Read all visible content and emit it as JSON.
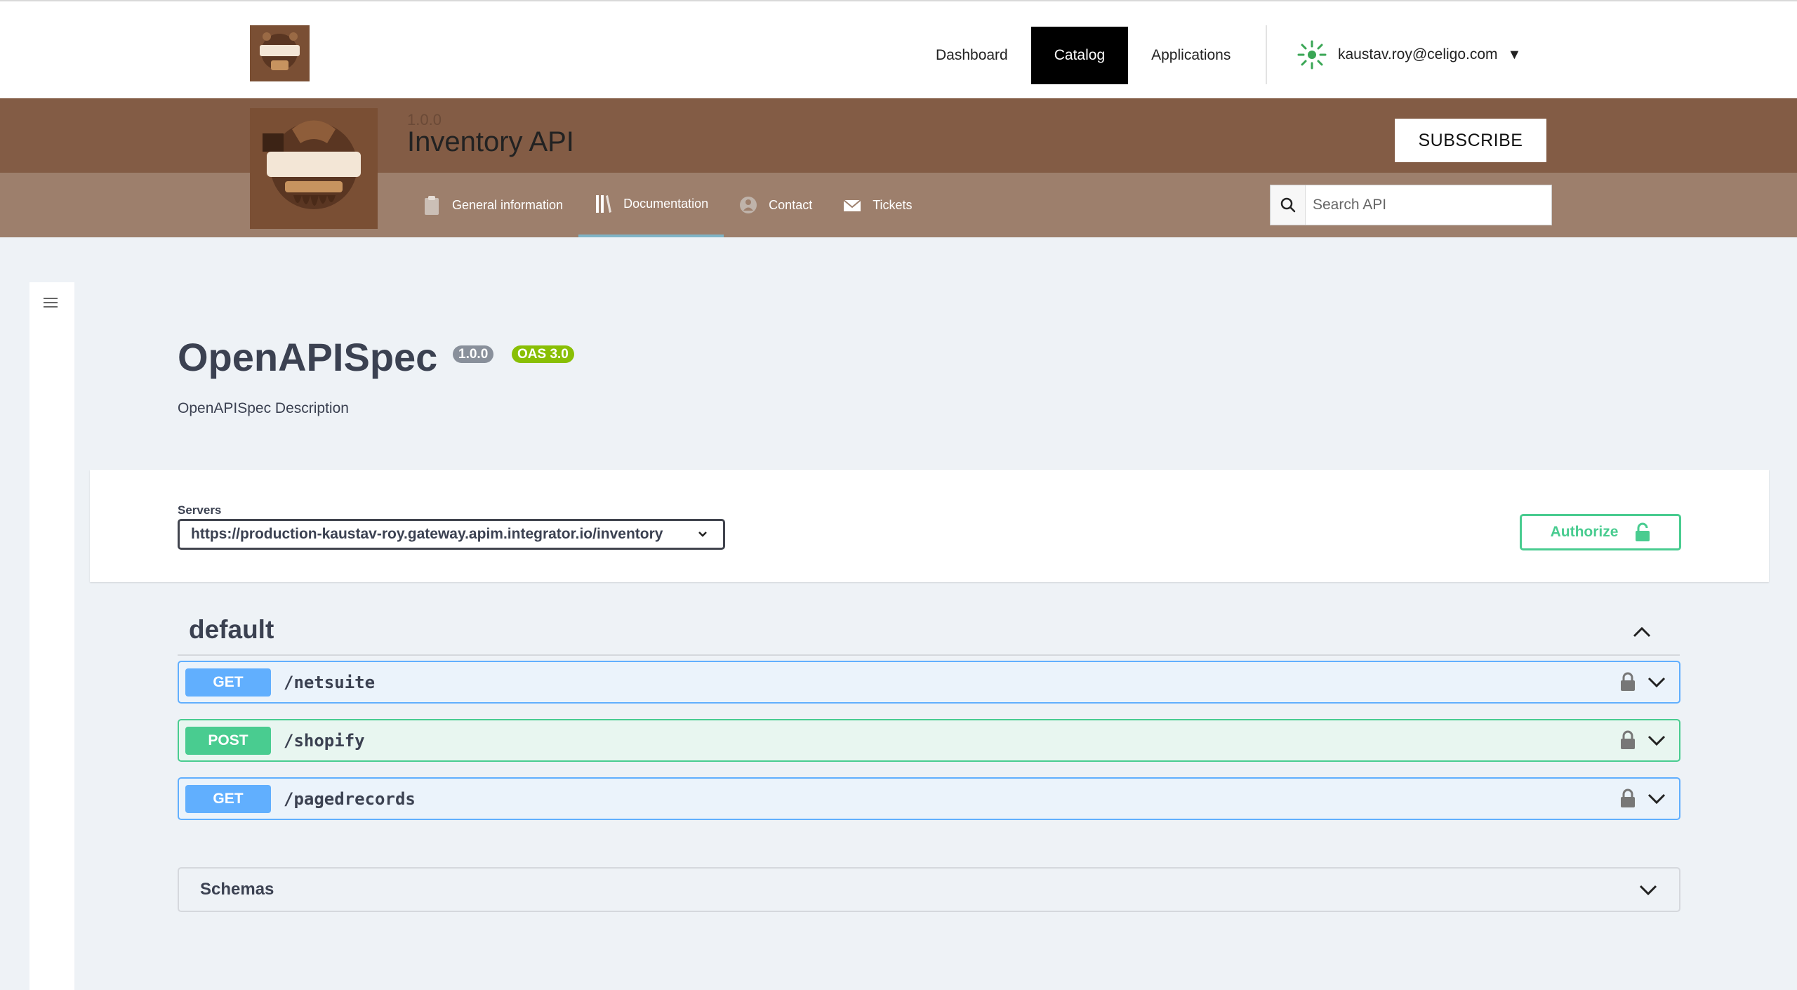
{
  "nav": {
    "links": [
      "Dashboard",
      "Catalog",
      "Applications"
    ],
    "active": "Catalog",
    "user_email": "kaustav.roy@celigo.com",
    "caret": "▼"
  },
  "api": {
    "version": "1.0.0",
    "title": "Inventory API",
    "subscribe_label": "SUBSCRIBE",
    "tabs": {
      "general": "General information",
      "documentation": "Documentation",
      "contact": "Contact",
      "tickets": "Tickets"
    },
    "search_placeholder": "Search API"
  },
  "spec": {
    "title": "OpenAPISpec",
    "version_badge": "1.0.0",
    "oas_badge": "OAS 3.0",
    "description": "OpenAPISpec Description",
    "servers_label": "Servers",
    "server_url": "https://production-kaustav-roy.gateway.apim.integrator.io/inventory",
    "authorize_label": "Authorize",
    "tag": "default",
    "operations": [
      {
        "method": "GET",
        "path": "/netsuite"
      },
      {
        "method": "POST",
        "path": "/shopify"
      },
      {
        "method": "GET",
        "path": "/pagedrecords"
      }
    ],
    "schemas_label": "Schemas"
  },
  "colors": {
    "band_top": "#835c45",
    "band_bottom": "#9d7f6c",
    "get": "#61affe",
    "post": "#49cc90",
    "authorize": "#49cc90"
  }
}
